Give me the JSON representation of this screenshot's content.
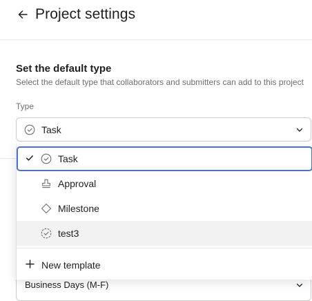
{
  "header": {
    "title": "Project settings"
  },
  "section": {
    "title": "Set the default type",
    "description": "Select the default type that collaborators and submitters can add to this project"
  },
  "type_field": {
    "label": "Type",
    "selected_value": "Task"
  },
  "dropdown": {
    "options": [
      {
        "label": "Task",
        "icon": "circle-check-icon",
        "checked": true
      },
      {
        "label": "Approval",
        "icon": "stamp-icon",
        "checked": false
      },
      {
        "label": "Milestone",
        "icon": "diamond-icon",
        "checked": false
      },
      {
        "label": "test3",
        "icon": "dashed-circle-check-icon",
        "checked": false,
        "hovered": true
      }
    ],
    "new_template_label": "New template"
  },
  "background": {
    "lower_select_value": "Business Days (M-F)"
  },
  "colors": {
    "accent_border": "#4573d2",
    "hover_bg": "#f2f2f2",
    "muted_text": "#6d6e6f"
  }
}
